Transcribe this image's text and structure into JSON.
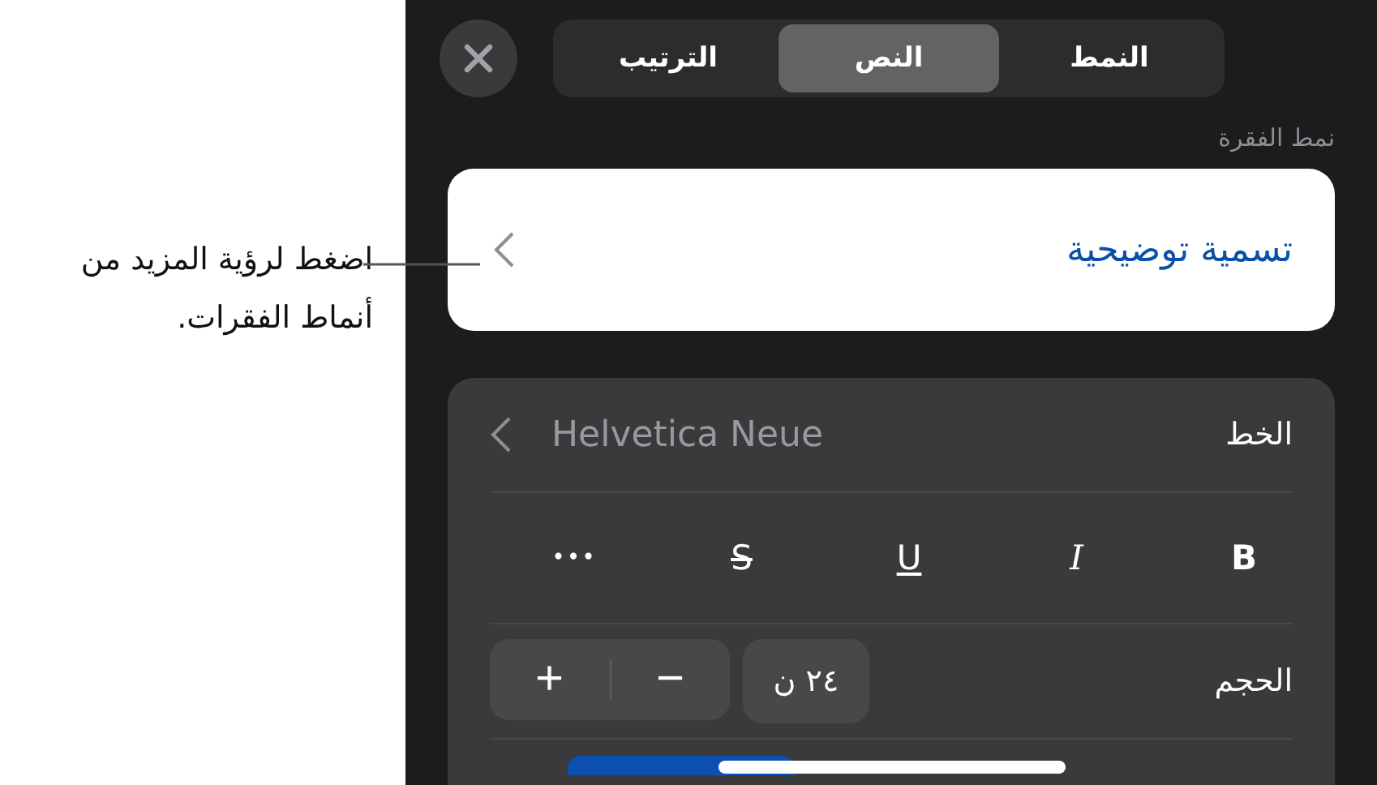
{
  "callout": {
    "text": "اضغط لرؤية المزيد من أنماط الفقرات."
  },
  "tabs": [
    {
      "label": "النمط",
      "selected": false
    },
    {
      "label": "النص",
      "selected": true
    },
    {
      "label": "الترتيب",
      "selected": false
    }
  ],
  "paragraph_style": {
    "label": "نمط الفقرة",
    "value": "تسمية توضيحية"
  },
  "font": {
    "label": "الخط",
    "value": "Helvetica Neue"
  },
  "style_buttons": [
    {
      "kind": "bold",
      "label": "B"
    },
    {
      "kind": "italic",
      "label": "I"
    },
    {
      "kind": "underline",
      "label": "U"
    },
    {
      "kind": "strikethrough",
      "label": "S"
    },
    {
      "kind": "more",
      "label": "•••"
    }
  ],
  "size": {
    "label": "الحجم",
    "value": "٢٤ ن",
    "increase": "+",
    "decrease": "−"
  }
}
